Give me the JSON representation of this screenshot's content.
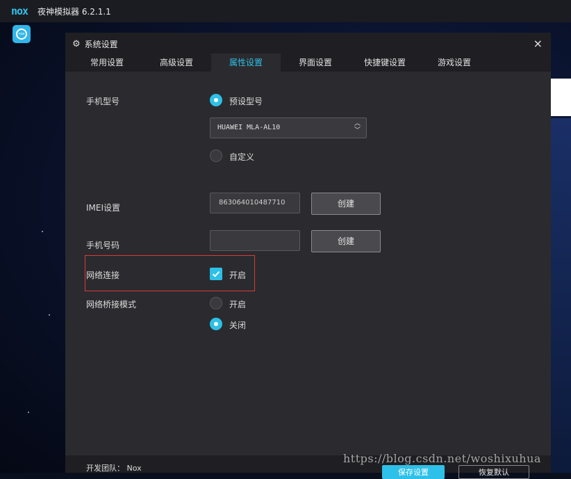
{
  "app": {
    "logo": "nox",
    "title": "夜神模拟器 6.2.1.1"
  },
  "dialog": {
    "title": "系统设置",
    "close": "×",
    "tabs": [
      "常用设置",
      "高级设置",
      "属性设置",
      "界面设置",
      "快捷键设置",
      "游戏设置"
    ],
    "active_tab": "属性设置"
  },
  "phone_model": {
    "label": "手机型号",
    "preset_label": "预设型号",
    "preset_selected": true,
    "select_value": "HUAWEI MLA-AL10",
    "custom_label": "自定义",
    "custom_selected": false
  },
  "imei": {
    "label": "IMEI设置",
    "value": "863064010487710",
    "button": "创建"
  },
  "phone_number": {
    "label": "手机号码",
    "value": "",
    "button": "创建"
  },
  "network": {
    "label": "网络连接",
    "option": "开启",
    "checked": true
  },
  "bridge": {
    "label": "网络桥接模式",
    "on_label": "开启",
    "on_selected": false,
    "off_label": "关闭",
    "off_selected": true
  },
  "footer": {
    "team": "开发团队：  Nox",
    "save_button": "保存设置",
    "restore_button": "恢复默认"
  },
  "watermark": "https://blog.csdn.net/woshixuhua",
  "colors": {
    "accent": "#2dc0e8",
    "highlight_border": "#d83a3a",
    "dialog_bg": "#2b2b2f"
  }
}
